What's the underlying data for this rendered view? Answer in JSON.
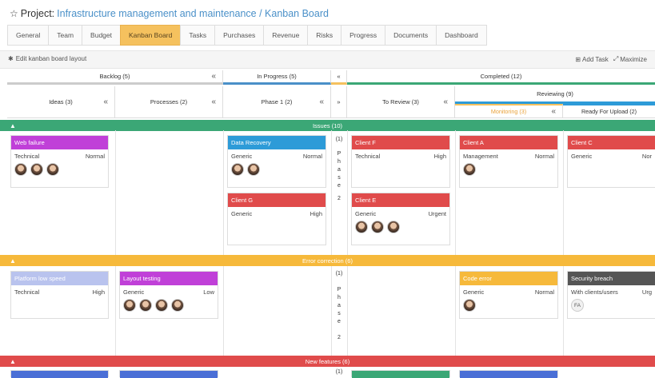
{
  "project": {
    "label": "Project:",
    "breadcrumb": "Infrastructure management and maintenance / Kanban Board"
  },
  "tabs": [
    "General",
    "Team",
    "Budget",
    "Kanban Board",
    "Tasks",
    "Purchases",
    "Revenue",
    "Risks",
    "Progress",
    "Documents",
    "Dashboard"
  ],
  "active_tab": "Kanban Board",
  "toolbar": {
    "edit_label": "Edit kanban board layout",
    "add_task": "Add Task",
    "maximize": "Maximize"
  },
  "columns": {
    "backlog": "Backlog (5)",
    "in_progress": "In Progress (5)",
    "completed": "Completed (12)",
    "ideas": "Ideas (3)",
    "processes": "Processes (2)",
    "phase1": "Phase 1 (2)",
    "to_review": "To Review (3)",
    "reviewing": "Reviewing (9)",
    "monitoring": "Monitoring (3)",
    "ready_upload": "Ready For Upload (2)"
  },
  "lanes": {
    "issues": "Issues  (10)",
    "error": "Error correction  (6)",
    "features": "New features  (6)"
  },
  "phase_text": {
    "num": "(1)",
    "letters": [
      "P",
      "h",
      "a",
      "s",
      "e"
    ],
    "end": "2"
  },
  "cards": {
    "web_failure": {
      "title": "Web failure",
      "type": "Technical",
      "priority": "Normal"
    },
    "data_recovery": {
      "title": "Data Recovery",
      "type": "Generic",
      "priority": "Normal"
    },
    "client_g": {
      "title": "Client G",
      "type": "Generic",
      "priority": "High"
    },
    "client_f": {
      "title": "Client F",
      "type": "Technical",
      "priority": "High"
    },
    "client_e": {
      "title": "Client E",
      "type": "Generic",
      "priority": "Urgent"
    },
    "client_a": {
      "title": "Client A",
      "type": "Management",
      "priority": "Normal"
    },
    "client_c": {
      "title": "Client C",
      "type": "Generic",
      "priority": "Nor"
    },
    "platform": {
      "title": "Platform low speed",
      "type": "Technical",
      "priority": "High"
    },
    "layout": {
      "title": "Layout testing",
      "type": "Generic",
      "priority": "Low"
    },
    "code_error": {
      "title": "Code error",
      "type": "Generic",
      "priority": "Normal"
    },
    "security": {
      "title": "Security breach",
      "type": "With clients/users",
      "priority": "Urg",
      "avatar_initials": "FA"
    }
  },
  "colors": {
    "issues": "#3ba776",
    "error": "#f6b93b",
    "features": "#e04b4b",
    "purple": "#c040d8",
    "blue": "#2d9bd8",
    "red": "#e04b4b",
    "lavender": "#b9c3ee",
    "yellow": "#f6b93b",
    "dark": "#555555"
  }
}
